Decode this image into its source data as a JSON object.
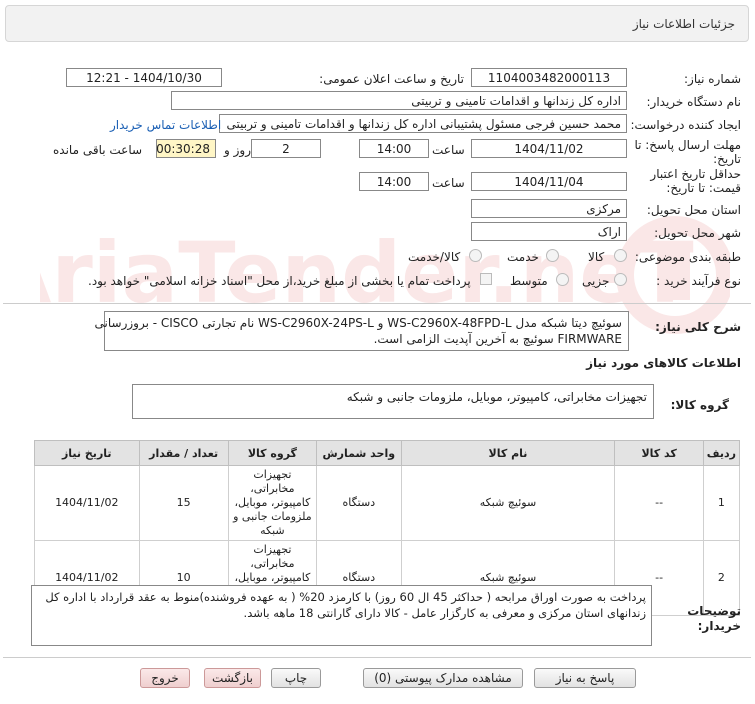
{
  "header": {
    "title": "جزئیات اطلاعات نیاز"
  },
  "fields": {
    "need_number_label": "شماره نیاز:",
    "need_number": "1104003482000113",
    "announce_label": "تاریخ و ساعت اعلان عمومی:",
    "announce_value": "1404/10/30 - 12:21",
    "buyer_org_label": "نام دستگاه خریدار:",
    "buyer_org": "اداره کل زندانها و اقدامات تامینی و تربیتی",
    "creator_label": "ایجاد کننده درخواست:",
    "creator": "محمد حسین فرجی مسئول پشتیبانی اداره کل زندانها و اقدامات تامینی و تربیتی",
    "contact_link": "اطلاعات تماس خریدار",
    "reply_deadline_label_1": "مهلت ارسال پاسخ: تا",
    "reply_deadline_label_2": "تاریخ:",
    "reply_date": "1404/11/02",
    "time_label": "ساعت",
    "reply_time": "14:00",
    "days_value": "2",
    "days_label": "روز و",
    "remaining_value": "00:30:28",
    "remaining_label": "ساعت باقی مانده",
    "validity_label_1": "حداقل تاریخ اعتبار",
    "validity_label_2": "قیمت: تا تاریخ:",
    "validity_date": "1404/11/04",
    "validity_time": "14:00",
    "province_label": "استان محل تحویل:",
    "province": "مرکزی",
    "city_label": "شهر محل تحویل:",
    "city": "اراک",
    "category_label": "طبقه بندی موضوعی:",
    "category_options": [
      "کالا",
      "خدمت",
      "کالا/خدمت"
    ],
    "process_label": "نوع فرآیند خرید :",
    "process_options": [
      "جزیی",
      "متوسط"
    ],
    "payment_note": "پرداخت تمام یا بخشی از مبلغ خرید،از محل \"اسناد خزانه اسلامی\" خواهد بود."
  },
  "summary": {
    "label": "شرح کلی نیاز:",
    "line1": "سوئیچ دیتا شبکه مدل WS-C2960X-48FPD-L و WS-C2960X-24PS-L نام تجارتی CISCO - بروزرسانی",
    "line2": "FIRMWARE سوئیچ به آخرین آپدیت الزامی است."
  },
  "goods": {
    "section_title": "اطلاعات کالاهای مورد نیاز",
    "group_label": "گروه کالا:",
    "group_value": "تجهیزات مخابراتی، کامپیوتر، موبایل، ملزومات جانبی و شبکه",
    "columns": [
      "ردیف",
      "کد کالا",
      "نام کالا",
      "واحد شمارش",
      "گروه کالا",
      "تعداد / مقدار",
      "تاریخ نیاز"
    ],
    "rows": [
      {
        "index": "1",
        "code": "--",
        "name": "سوئیچ شبکه",
        "unit": "دستگاه",
        "group": "تجهیزات مخابراتی، کامپیوتر، موبایل، ملزومات جانبی و شبکه",
        "qty": "15",
        "date": "1404/11/02"
      },
      {
        "index": "2",
        "code": "--",
        "name": "سوئیچ شبکه",
        "unit": "دستگاه",
        "group": "تجهیزات مخابراتی، کامپیوتر، موبایل، ملزومات جانبی و شبکه",
        "qty": "10",
        "date": "1404/11/02"
      }
    ]
  },
  "buyer_notes": {
    "label_1": "توضیحات",
    "label_2": "خریدار:",
    "line1": "پرداخت به صورت اوراق مرابحه ( حداکثر 45 ال 60 روز) با کارمزد 20% ( به عهده فروشنده)منوط به عقد قرارداد با اداره کل",
    "line2": "زندانهای استان مرکزی و معرفی به کارگزار عامل - کالا دارای گارانتی 18 ماهه باشد."
  },
  "buttons": {
    "reply": "پاسخ به نیاز",
    "attachments": "مشاهده مدارک پیوستی (0)",
    "print": "چاپ",
    "back": "بازگشت",
    "exit": "خروج"
  },
  "watermark": "AriaTender.neT",
  "colors": {
    "link": "#1a5fb4",
    "highlight": "#fff6c6",
    "header_bg": "#f2f2f2"
  }
}
